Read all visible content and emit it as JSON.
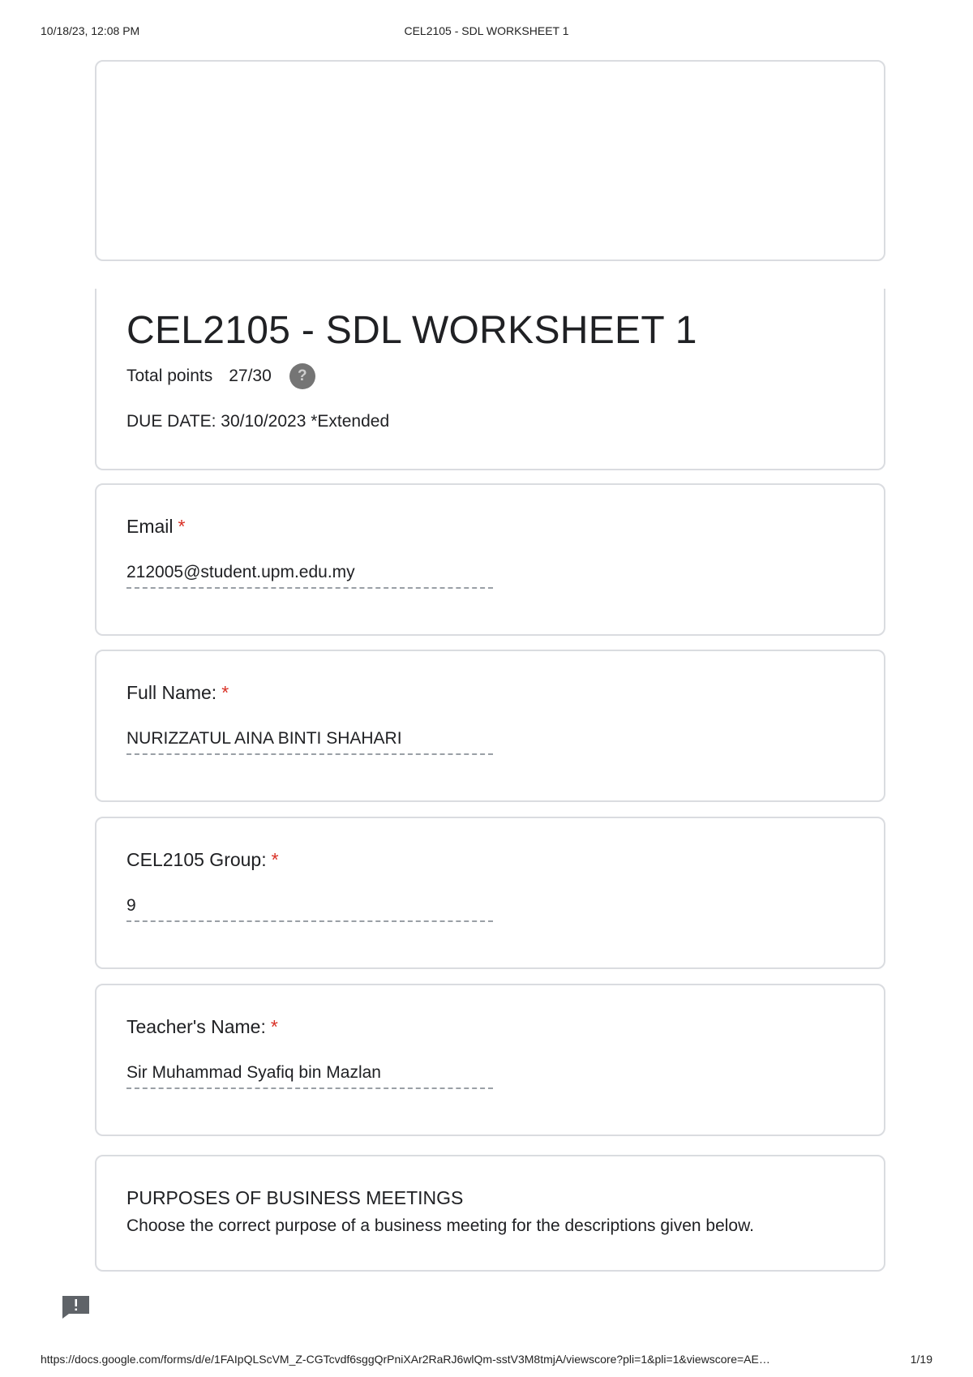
{
  "print_header": {
    "datetime": "10/18/23, 12:08 PM",
    "doc_title": "CEL2105 - SDL WORKSHEET 1"
  },
  "form": {
    "title": "CEL2105 - SDL WORKSHEET 1",
    "total_points_label": "Total points",
    "total_points_value": "27/30",
    "help_icon_glyph": "?",
    "due_date": "DUE DATE:  30/10/2023 *Extended"
  },
  "questions": [
    {
      "label": "Email",
      "required_mark": "*",
      "answer": "212005@student.upm.edu.my"
    },
    {
      "label": "Full Name:",
      "required_mark": "*",
      "answer": "NURIZZATUL AINA BINTI SHAHARI"
    },
    {
      "label": "CEL2105 Group:",
      "required_mark": "*",
      "answer": "9"
    },
    {
      "label": "Teacher's Name:",
      "required_mark": "*",
      "answer": "Sir Muhammad Syafiq bin Mazlan"
    }
  ],
  "section": {
    "title": "PURPOSES OF BUSINESS MEETINGS",
    "description": "Choose the correct purpose of a business meeting for the descriptions given below."
  },
  "icons": {
    "help": "help-circle-icon",
    "feedback": "feedback-icon"
  },
  "colors": {
    "required": "#d93025",
    "card_border": "#dadce0",
    "help_icon_bg": "#757575"
  },
  "print_footer": {
    "url": "https://docs.google.com/forms/d/e/1FAIpQLScVM_Z-CGTcvdf6sggQrPniXAr2RaRJ6wlQm-sstV3M8tmjA/viewscore?pli=1&pli=1&viewscore=AE…",
    "page": "1/19"
  }
}
